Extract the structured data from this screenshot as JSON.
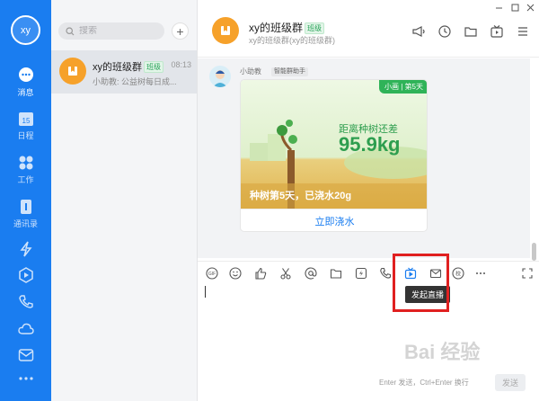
{
  "user": {
    "avatar_text": "xy"
  },
  "nav": [
    {
      "name": "nav-messages",
      "label": "消息",
      "icon": "chat-bubble-icon",
      "active": true
    },
    {
      "name": "nav-calendar",
      "label": "日程",
      "icon": "calendar-icon",
      "date": "15"
    },
    {
      "name": "nav-work",
      "label": "工作",
      "icon": "apps-grid-icon"
    },
    {
      "name": "nav-contacts",
      "label": "通讯录",
      "icon": "contacts-book-icon"
    },
    {
      "name": "nav-lightning",
      "icon": "lightning-icon"
    },
    {
      "name": "nav-hexagon",
      "icon": "hexagon-icon"
    },
    {
      "name": "nav-phone",
      "icon": "phone-icon"
    },
    {
      "name": "nav-cloud",
      "icon": "cloud-icon"
    },
    {
      "name": "nav-mail",
      "icon": "mail-icon"
    },
    {
      "name": "nav-more",
      "icon": "more-dots-icon"
    }
  ],
  "search": {
    "placeholder": "搜索"
  },
  "conversations": [
    {
      "name": "xy的班级群",
      "badge": "班级",
      "time": "08:13",
      "preview": "小助教: 公益树每日成..."
    }
  ],
  "group": {
    "name": "xy的班级群",
    "badge": "班级",
    "subtitle": "xy的班级群(xy的班级群)"
  },
  "message": {
    "sender": "小助教",
    "sender_tag": "智能群助手",
    "card": {
      "corner": "小画 | 第5天",
      "distance_label": "距离种树还差",
      "distance_value": "95.9kg",
      "progress_text": "种树第5天，已浇水20g",
      "action": "立即浇水"
    }
  },
  "toolbar": {
    "items": [
      "gif-icon",
      "emoji-icon",
      "thumbs-up-icon",
      "scissors-icon",
      "at-icon",
      "folder-icon",
      "flash-icon",
      "phone-icon",
      "live-stream-icon",
      "mail-icon",
      "school-icon",
      "more-icon"
    ],
    "tooltip": "发起直播",
    "highlight_color": "#e02020"
  },
  "compose": {
    "send_hint": "Enter 发送，Ctrl+Enter 换行",
    "send_label": "发送"
  },
  "watermark": "Bai 经验",
  "colors": {
    "accent": "#1a7df0",
    "rail": "#1a7df0",
    "group_avatar": "#f6a12a",
    "green": "#2fb358"
  }
}
